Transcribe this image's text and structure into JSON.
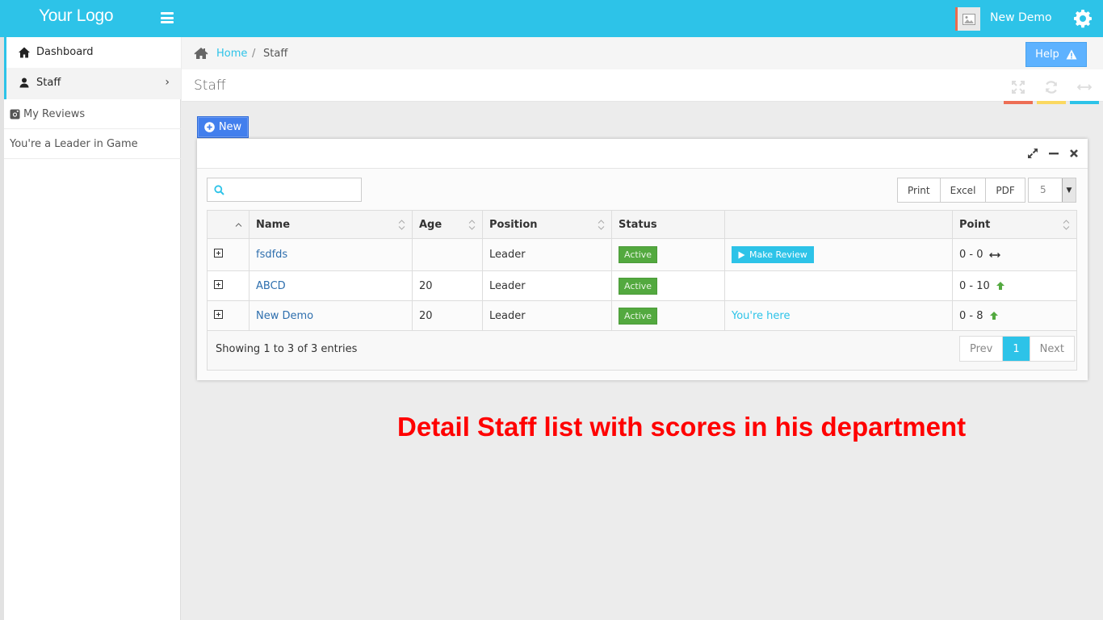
{
  "header": {
    "logo": "Your Logo",
    "username": "New Demo",
    "accent_color": "#2dc3e8"
  },
  "sidebar": {
    "items": [
      {
        "label": "Dashboard",
        "icon": "home-icon"
      },
      {
        "label": "Staff",
        "icon": "user-icon"
      }
    ],
    "sub_items": [
      {
        "label": "My Reviews",
        "icon": "instagram-icon"
      },
      {
        "label": "You're a Leader in Game"
      }
    ]
  },
  "breadcrumb": {
    "home": "Home",
    "separator": "/",
    "current": "Staff"
  },
  "help_label": "Help",
  "page_title": "Staff",
  "new_button": "New",
  "table_tools": {
    "search_placeholder": "",
    "export_buttons": [
      "Print",
      "Excel",
      "PDF"
    ],
    "page_length": "5"
  },
  "table": {
    "columns": [
      "",
      "Name",
      "Age",
      "Position",
      "Status",
      "",
      "Point"
    ],
    "rows": [
      {
        "name": "fsdfds",
        "age": "",
        "position": "Leader",
        "status": "Active",
        "action": "Make Review",
        "action_type": "button",
        "point": "0 - 0",
        "trend": "neutral"
      },
      {
        "name": "ABCD",
        "age": "20",
        "position": "Leader",
        "status": "Active",
        "action": "",
        "action_type": "none",
        "point": "0 - 10",
        "trend": "up"
      },
      {
        "name": "New Demo",
        "age": "20",
        "position": "Leader",
        "status": "Active",
        "action": "You're here",
        "action_type": "link",
        "point": "0 - 8",
        "trend": "up"
      }
    ],
    "info": "Showing 1 to 3 of 3 entries",
    "pagination": {
      "prev": "Prev",
      "current": "1",
      "next": "Next"
    }
  },
  "annotation": "Detail Staff list with scores in his department",
  "colors": {
    "status_active": "#53a93f",
    "trend_up": "#53a93f",
    "annotation": "#ff0000"
  }
}
